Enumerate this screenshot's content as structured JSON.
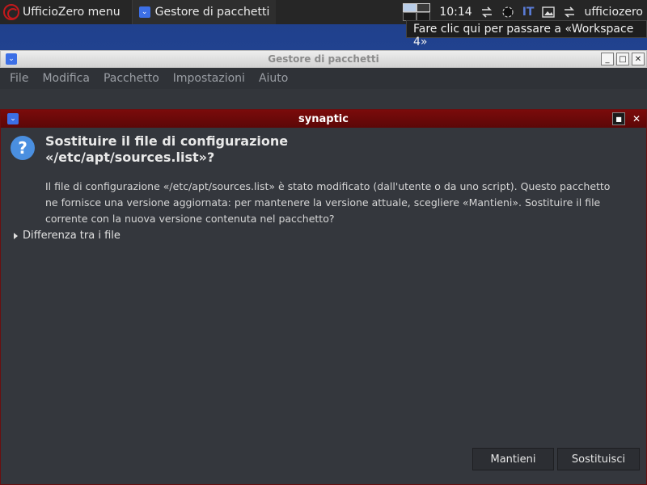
{
  "taskbar": {
    "menu_label": "UfficioZero menu",
    "task_label": "Gestore di pacchetti",
    "clock": "10:14",
    "keyboard_layout": "IT",
    "username": "ufficiozero"
  },
  "tooltip": {
    "text": "Fare clic qui per passare a «Workspace 4»"
  },
  "main_window": {
    "title": "Gestore di pacchetti",
    "menu": [
      "File",
      "Modifica",
      "Pacchetto",
      "Impostazioni",
      "Aiuto"
    ]
  },
  "dialog": {
    "title": "synaptic",
    "heading_line1": "Sostituire il file di configurazione",
    "heading_line2": "«/etc/apt/sources.list»?",
    "body_line1": "Il file di configurazione «/etc/apt/sources.list» è stato modificato (dall'utente o da uno script). Questo pacchetto",
    "body_line2": "ne fornisce una versione aggiornata: per mantenere la versione attuale, scegliere «Mantieni». Sostituire il file",
    "body_line3": "corrente con la nuova versione contenuta nel pacchetto?",
    "expander_label": "Differenza tra i file",
    "keep_button": "Mantieni",
    "replace_button": "Sostituisci"
  },
  "colors": {
    "dialog_titlebar": "#7b0b0b",
    "dialog_bg": "#34373d",
    "question_icon": "#4a8fe0",
    "taskbar_bg": "#262626"
  }
}
